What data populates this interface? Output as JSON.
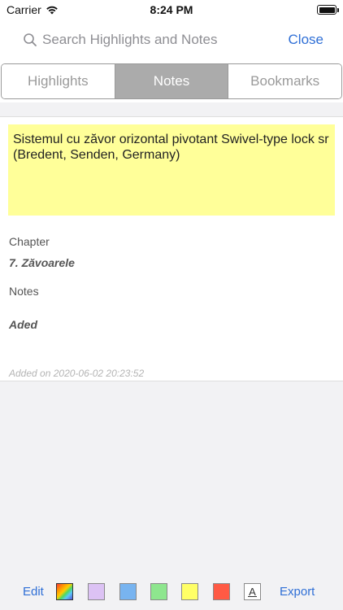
{
  "status_bar": {
    "carrier": "Carrier",
    "time": "8:24 PM"
  },
  "header": {
    "search_placeholder": "Search Highlights and Notes",
    "close_label": "Close"
  },
  "tabs": [
    {
      "label": "Highlights",
      "active": false
    },
    {
      "label": "Notes",
      "active": true
    },
    {
      "label": "Bookmarks",
      "active": false
    }
  ],
  "note": {
    "highlight_text": "Sistemul cu zăvor orizontal pivotant Swivel-type lock sr (Bredent, Senden, Germany)",
    "highlight_color": "#ffff99",
    "chapter_label": "Chapter",
    "chapter_value": "7. Zăvoarele",
    "notes_label": "Notes",
    "notes_value": "Aded",
    "added_on": "Added on 2020-06-02 20:23:52"
  },
  "toolbar": {
    "edit_label": "Edit",
    "export_label": "Export",
    "swatches": [
      {
        "name": "multicolor",
        "color": "gradient"
      },
      {
        "name": "purple",
        "color": "#dcc2f4"
      },
      {
        "name": "blue",
        "color": "#78b4f0"
      },
      {
        "name": "green",
        "color": "#8ee68e"
      },
      {
        "name": "yellow",
        "color": "#ffff66"
      },
      {
        "name": "red",
        "color": "#ff5a44"
      }
    ],
    "font_icon_glyph": "A"
  }
}
